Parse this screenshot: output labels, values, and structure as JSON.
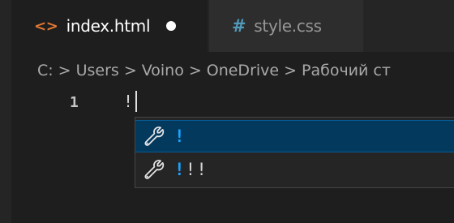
{
  "tabs": [
    {
      "label": "index.html",
      "icon": "html-file-icon",
      "icon_glyph": "<>",
      "active": true,
      "dirty": true
    },
    {
      "label": "style.css",
      "icon": "css-file-icon",
      "icon_glyph": "#",
      "active": false,
      "dirty": false
    }
  ],
  "breadcrumb": {
    "items": [
      "C:",
      "Users",
      "Voino",
      "OneDrive",
      "Рабочий ст"
    ],
    "separator": ">"
  },
  "editor": {
    "line_number": "1",
    "line_text": "!"
  },
  "suggestions": [
    {
      "match": "!",
      "rest": "",
      "icon": "wrench-icon",
      "selected": true
    },
    {
      "match": "!",
      "rest": "!!",
      "icon": "wrench-icon",
      "selected": false
    }
  ],
  "colors": {
    "editor_bg": "#1e1e1e",
    "tabbar_bg": "#252526",
    "html_icon": "#e37933",
    "css_icon": "#519aba",
    "suggest_selected_bg": "#04395e",
    "suggest_match": "#18a3ff"
  }
}
